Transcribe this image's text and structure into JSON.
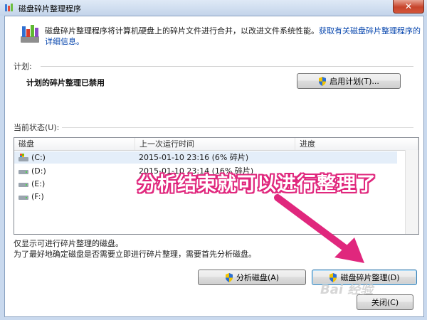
{
  "window": {
    "title": "磁盘碎片整理程序",
    "close_glyph": "✕"
  },
  "header": {
    "description": "磁盘碎片整理程序将计算机硬盘上的碎片文件进行合并，以改进文件系统性能。",
    "link_text": "获取有关磁盘碎片整理程序的详细信息。"
  },
  "schedule": {
    "section_label": "计划:",
    "status": "计划的碎片整理已禁用",
    "enable_button": "启用计划(T)..."
  },
  "current_status": {
    "section_label": "当前状态(U):",
    "columns": [
      "磁盘",
      "上一次运行时间",
      "进度"
    ],
    "rows": [
      {
        "disk": "(C:)",
        "last_run": "2015-01-10 23:16 (6% 碎片)",
        "icon": "system-drive-icon"
      },
      {
        "disk": "(D:)",
        "last_run": "2015-01-10 23:14 (16% 碎片)",
        "icon": "drive-icon"
      },
      {
        "disk": "(E:)",
        "last_run": "",
        "icon": "drive-icon"
      },
      {
        "disk": "(F:)",
        "last_run": "",
        "icon": "drive-icon"
      }
    ]
  },
  "notes": {
    "line1": "仅显示可进行碎片整理的磁盘。",
    "line2": "为了最好地确定磁盘是否需要立即进行碎片整理，需要首先分析磁盘。"
  },
  "buttons": {
    "analyze": "分析磁盘(A)",
    "defrag": "磁盘碎片整理(D)",
    "close": "关闭(C)"
  },
  "annotation": {
    "text": "分析结束就可以进行整理了",
    "color": "#e0277d"
  },
  "watermark": {
    "text": "Bai 经验"
  }
}
